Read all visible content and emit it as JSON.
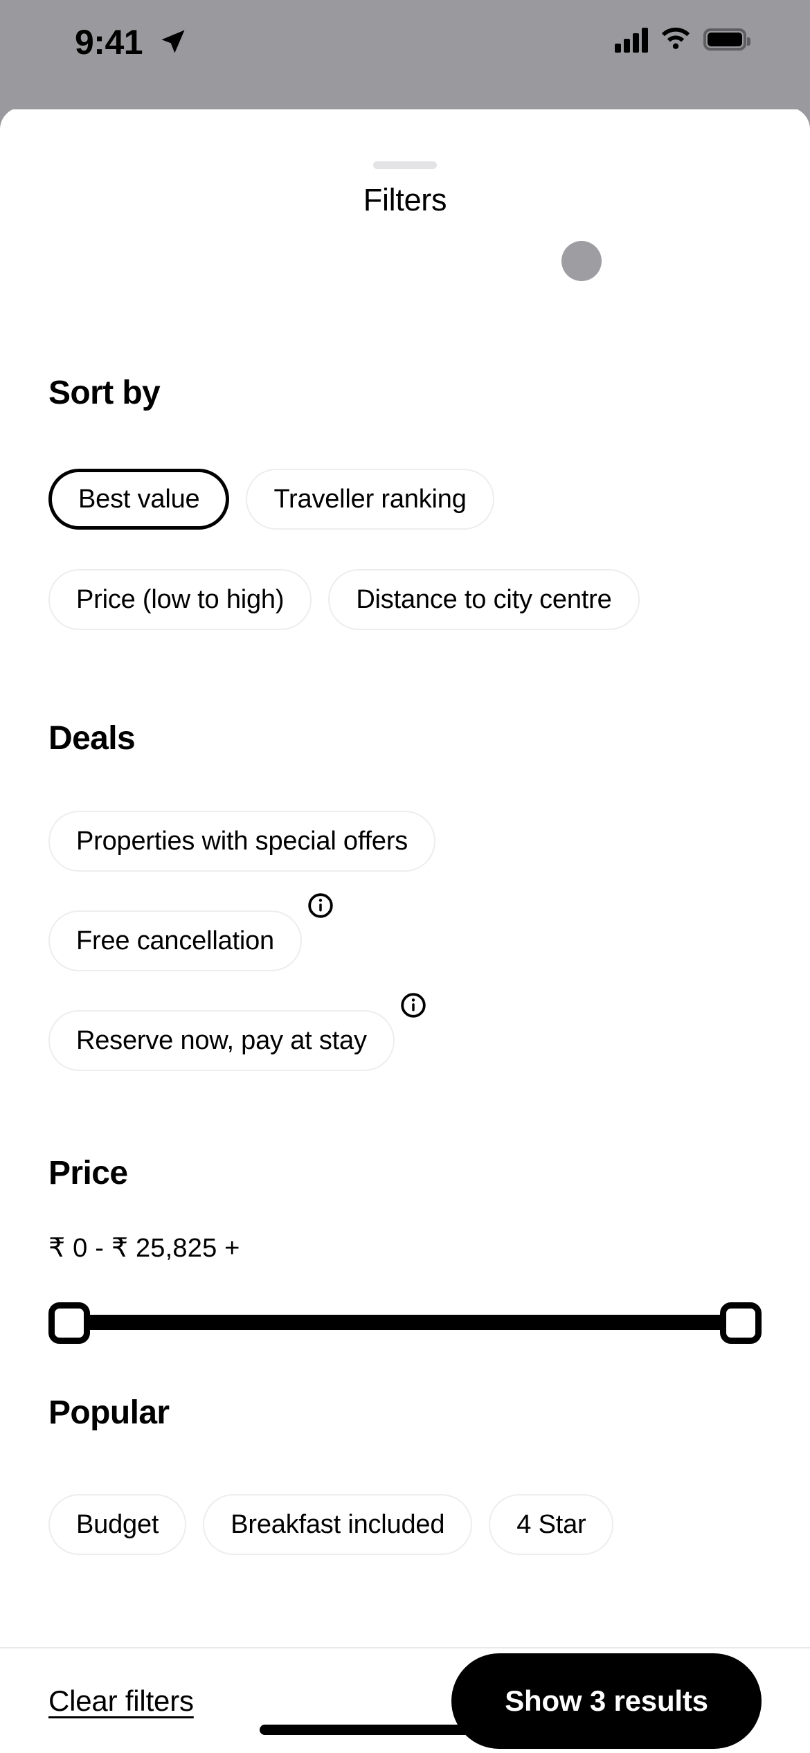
{
  "status_bar": {
    "time": "9:41",
    "icons": [
      "location-arrow-icon",
      "cellular-signal-icon",
      "wifi-icon",
      "battery-icon"
    ]
  },
  "sheet": {
    "title": "Filters",
    "grabber": "sheet-grabber-handle"
  },
  "sort_by": {
    "title": "Sort by",
    "options": [
      {
        "label": "Best value",
        "selected": true
      },
      {
        "label": "Traveller ranking",
        "selected": false
      },
      {
        "label": "Price (low to high)",
        "selected": false
      },
      {
        "label": "Distance to city centre",
        "selected": false
      }
    ]
  },
  "deals": {
    "title": "Deals",
    "options": [
      {
        "label": "Properties with special offers",
        "selected": false,
        "info": false
      },
      {
        "label": "Free cancellation",
        "selected": false,
        "info": true
      },
      {
        "label": "Reserve now, pay at stay",
        "selected": false,
        "info": true
      }
    ]
  },
  "price": {
    "title": "Price",
    "range_label": "₹ 0 - ₹ 25,825 +",
    "min_value": "0",
    "max_value": "25,825",
    "currency": "₹"
  },
  "popular": {
    "title": "Popular",
    "options": [
      {
        "label": "Budget",
        "selected": false
      },
      {
        "label": "Breakfast included",
        "selected": false
      },
      {
        "label": "4 Star",
        "selected": false
      }
    ]
  },
  "footer": {
    "clear_label": "Clear filters",
    "show_results_label": "Show 3 results",
    "results_count": "3"
  },
  "colors": {
    "accent": "#000000",
    "chip_border": "#eceded",
    "status_bar_bg": "#9a9a9e",
    "sheet_bg": "#ffffff",
    "grabber": "#e3e3e5",
    "touch_indicator": "#9d9da2"
  }
}
